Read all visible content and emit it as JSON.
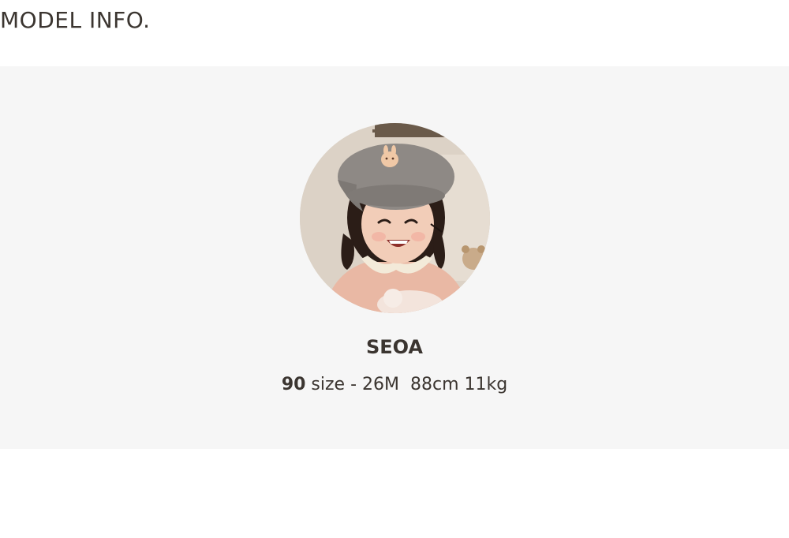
{
  "section": {
    "title": "MODEL INFO."
  },
  "model": {
    "photo_alt": "SEOA",
    "name": "SEOA",
    "size_number": "90",
    "size_detail": " size - 26M  88cm 11kg"
  },
  "colors": {
    "text": "#3b3530",
    "panel_background": "#f6f6f6",
    "page_background": "#ffffff"
  }
}
